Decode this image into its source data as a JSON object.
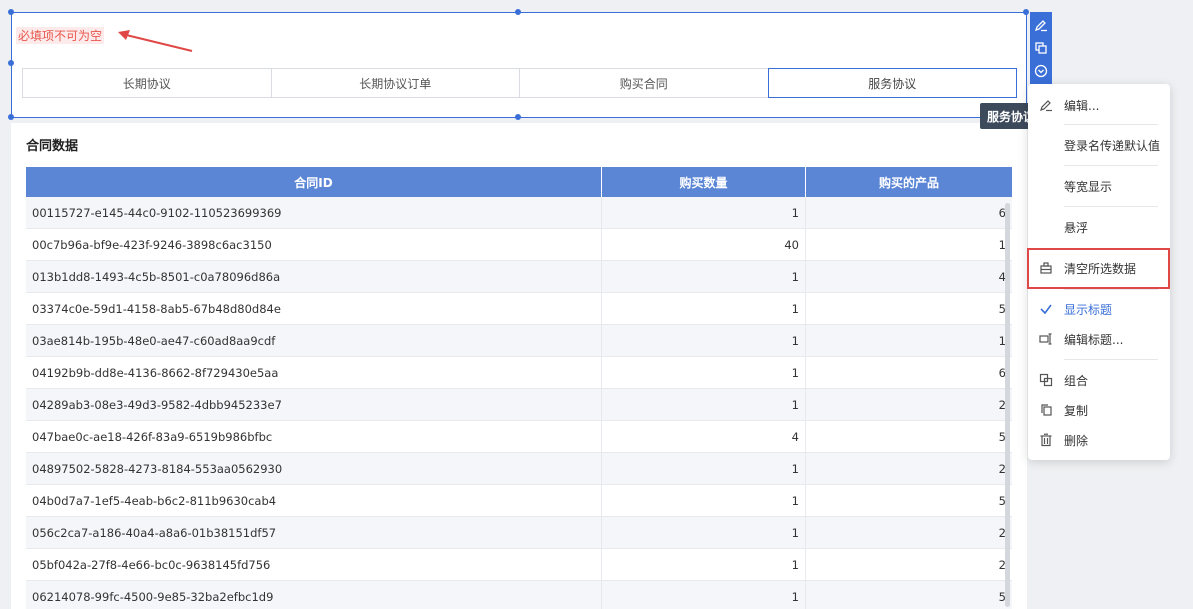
{
  "widget": {
    "required_tip": "必填项不可为空",
    "tabs": [
      "长期协议",
      "长期协议订单",
      "购买合同",
      "服务协议"
    ],
    "active_tab": 3
  },
  "tooltip": "服务协议",
  "panel": {
    "title": "合同数据",
    "columns": [
      "合同ID",
      "购买数量",
      "购买的产品"
    ],
    "rows": [
      [
        "00115727-e145-44c0-9102-110523699369",
        "1",
        "6"
      ],
      [
        "00c7b96a-bf9e-423f-9246-3898c6ac3150",
        "40",
        "1"
      ],
      [
        "013b1dd8-1493-4c5b-8501-c0a78096d86a",
        "1",
        "4"
      ],
      [
        "03374c0e-59d1-4158-8ab5-67b48d80d84e",
        "1",
        "5"
      ],
      [
        "03ae814b-195b-48e0-ae47-c60ad8aa9cdf",
        "1",
        "1"
      ],
      [
        "04192b9b-dd8e-4136-8662-8f729430e5aa",
        "1",
        "6"
      ],
      [
        "04289ab3-08e3-49d3-9582-4dbb945233e7",
        "1",
        "2"
      ],
      [
        "047bae0c-ae18-426f-83a9-6519b986bfbc",
        "4",
        "5"
      ],
      [
        "04897502-5828-4273-8184-553aa0562930",
        "1",
        "2"
      ],
      [
        "04b0d7a7-1ef5-4eab-b6c2-811b9630cab4",
        "1",
        "5"
      ],
      [
        "056c2ca7-a186-40a4-a8a6-01b38151df57",
        "1",
        "2"
      ],
      [
        "05bf042a-27f8-4e66-bc0c-9638145fd756",
        "1",
        "2"
      ],
      [
        "06214078-99fc-4500-9e85-32ba2efbc1d9",
        "1",
        "5"
      ]
    ]
  },
  "menu": {
    "items": [
      {
        "label": "编辑...",
        "icon": "edit-icon"
      },
      {
        "label": "登录名传递默认值",
        "icon": ""
      },
      {
        "label": "等宽显示",
        "icon": ""
      },
      {
        "label": "悬浮",
        "icon": ""
      },
      {
        "label": "清空所选数据",
        "icon": "clear-data-icon"
      },
      {
        "label": "显示标题",
        "icon": "check-icon"
      },
      {
        "label": "编辑标题...",
        "icon": "edit-title-icon"
      },
      {
        "label": "组合",
        "icon": "group-icon"
      },
      {
        "label": "复制",
        "icon": "copy-icon"
      },
      {
        "label": "删除",
        "icon": "trash-icon"
      }
    ]
  },
  "colors": {
    "accent": "#3a6fd8",
    "header": "#5b86d6",
    "error": "#e8584e",
    "highlight": "#e04848"
  }
}
